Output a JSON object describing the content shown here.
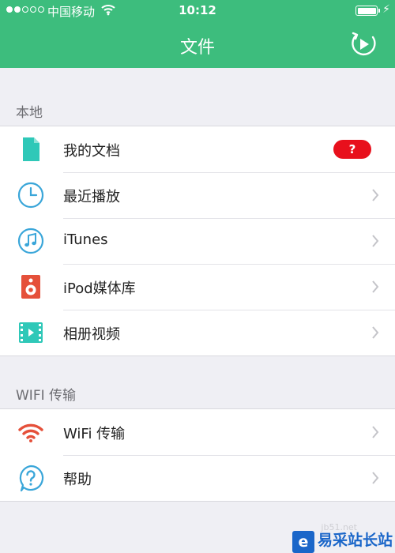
{
  "status_bar": {
    "carrier": "中国移动",
    "time": "10:12"
  },
  "nav": {
    "title": "文件",
    "action_icon": "play-circle-icon"
  },
  "sections": [
    {
      "header": "本地",
      "items": [
        {
          "label": "我的文档",
          "icon": "document-icon",
          "badge": "?"
        },
        {
          "label": "最近播放",
          "icon": "clock-icon"
        },
        {
          "label": "iTunes",
          "icon": "music-note-icon"
        },
        {
          "label": "iPod媒体库",
          "icon": "speaker-icon"
        },
        {
          "label": "相册视频",
          "icon": "film-icon"
        }
      ]
    },
    {
      "header": "WIFI 传输",
      "items": [
        {
          "label": "WiFi 传输",
          "icon": "wifi-icon"
        },
        {
          "label": "帮助",
          "icon": "help-icon"
        }
      ]
    }
  ],
  "colors": {
    "accent": "#3dbd7d",
    "badge": "#e8101c",
    "teal_icon": "#2fc8b8",
    "blue_icon": "#3aa6d9",
    "red_icon": "#e5503a"
  },
  "watermark": {
    "logo": "e",
    "text": "易采站长站",
    "sub": "jb51.net"
  }
}
